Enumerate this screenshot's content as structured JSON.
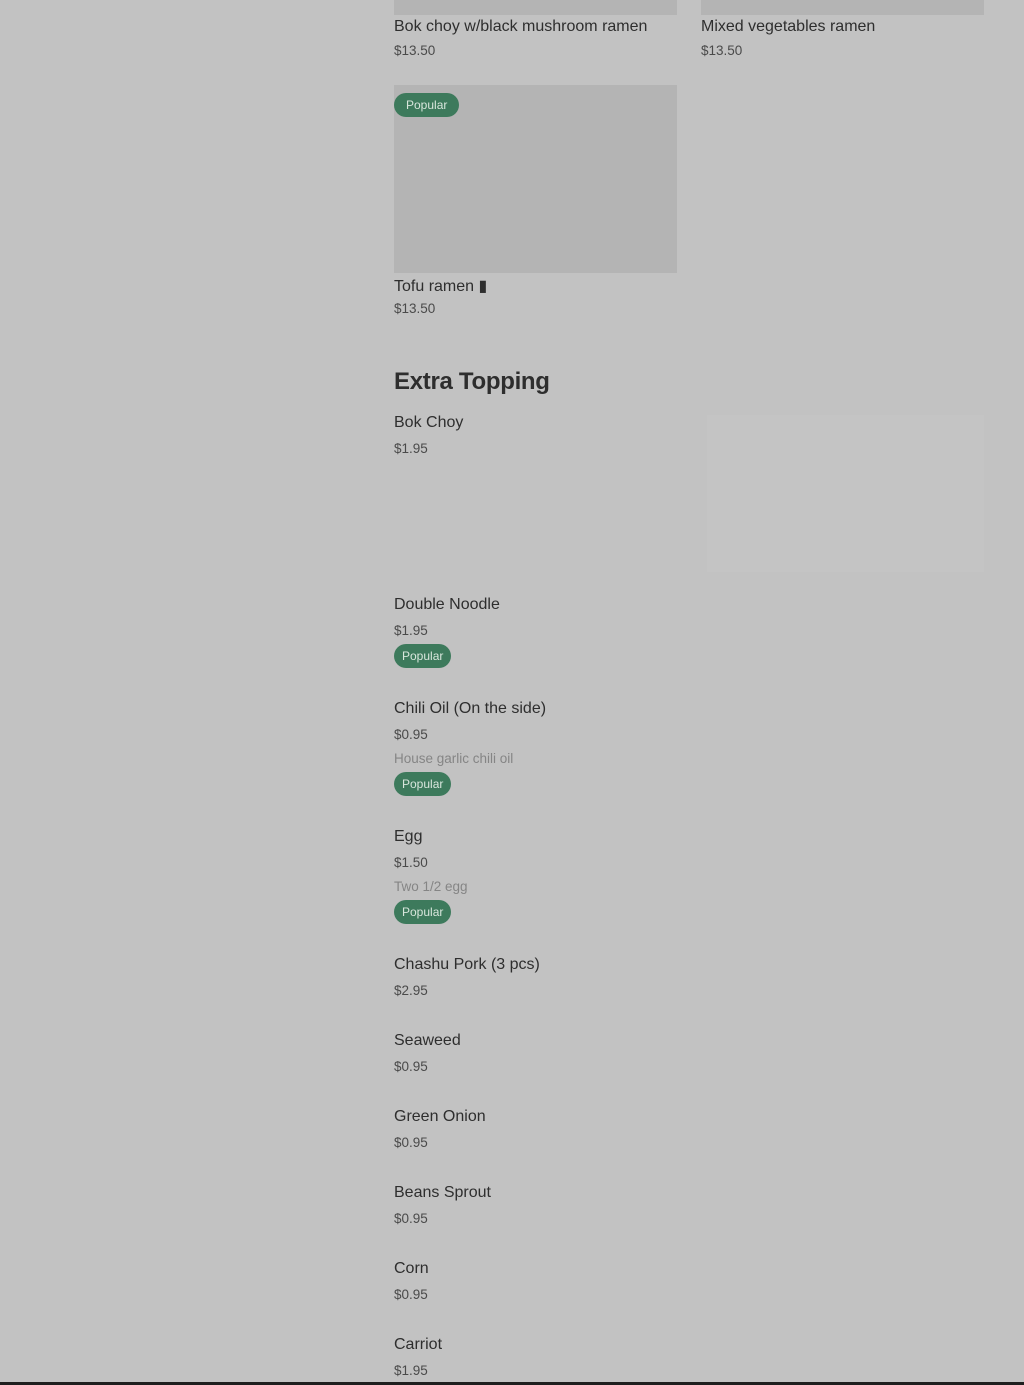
{
  "grid_items": [
    {
      "name": "Bok choy w/black mushroom ramen",
      "price": "$13.50"
    },
    {
      "name": "Mixed vegetables ramen",
      "price": "$13.50"
    },
    {
      "name": "Tofu ramen ▮",
      "price": "$13.50",
      "badge": "Popular"
    }
  ],
  "section": {
    "title": "Extra Topping"
  },
  "toppings": [
    {
      "name": "Bok Choy",
      "price": "$1.95"
    },
    {
      "name": "Double Noodle",
      "price": "$1.95",
      "badge": "Popular"
    },
    {
      "name": "Chili Oil (On the side)",
      "price": "$0.95",
      "desc": "House garlic chili oil",
      "badge": "Popular"
    },
    {
      "name": "Egg",
      "price": "$1.50",
      "desc": "Two 1/2 egg",
      "badge": "Popular"
    },
    {
      "name": "Chashu Pork (3 pcs)",
      "price": "$2.95"
    },
    {
      "name": "Seaweed",
      "price": "$0.95"
    },
    {
      "name": "Green Onion",
      "price": "$0.95"
    },
    {
      "name": "Beans Sprout",
      "price": "$0.95"
    },
    {
      "name": "Corn",
      "price": "$0.95"
    },
    {
      "name": "Carriot",
      "price": "$1.95"
    }
  ],
  "colors": {
    "overlay_bg": "#c2c2c2",
    "badge_bg": "#3d7a5c"
  }
}
